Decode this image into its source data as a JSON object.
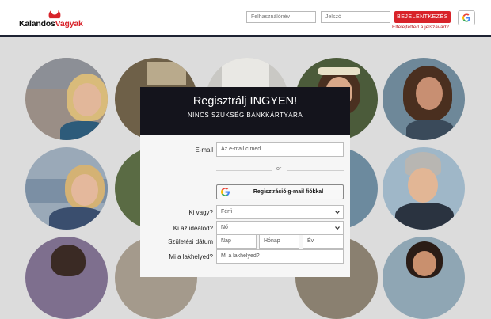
{
  "brand": {
    "logo_prefix": "Kalandos",
    "logo_suffix": "Vagyak",
    "accent": "#d8232a",
    "dark": "#14141c"
  },
  "header": {
    "username_placeholder": "Felhasználónév",
    "password_placeholder": "Jelszó",
    "login_label": "BEJELENTKEZÉS",
    "forgot_label": "Elfelejtetted a jelszavad?",
    "google_icon": "google-icon"
  },
  "register": {
    "title": "Regisztrálj INGYEN!",
    "subtitle": "NINCS SZÜKSÉG BANKKÁRTYÁRA",
    "email_label": "E-mail",
    "email_placeholder": "Az e-mail címed",
    "or_label": "or",
    "google_button_label": "Regisztráció g-mail fiókkal",
    "who_label": "Ki vagy?",
    "who_value": "Férfi",
    "ideal_label": "Ki az ideálod?",
    "ideal_value": "Nő",
    "birth_label": "Születési dátum",
    "day_placeholder": "Nap",
    "month_placeholder": "Hónap",
    "year_placeholder": "Év",
    "location_label": "Mi a lakhelyed?",
    "location_placeholder": "Mi a lakhelyed?"
  }
}
